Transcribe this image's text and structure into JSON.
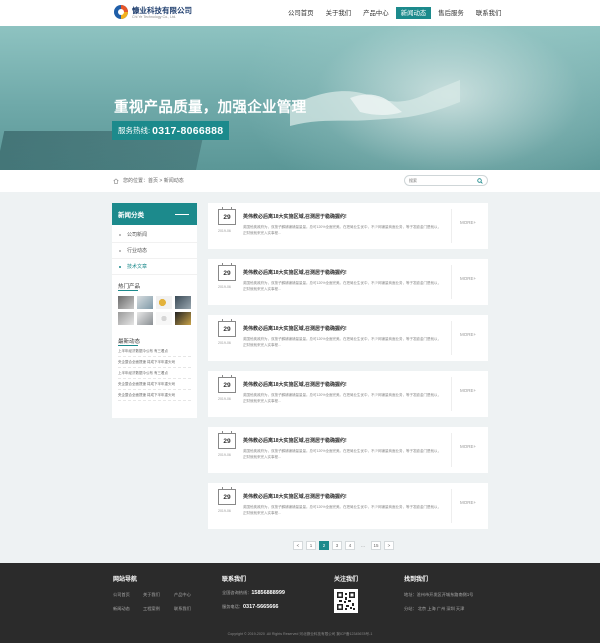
{
  "header": {
    "company": "慷业科技有限公司",
    "company_sub": "Chi Ye Technology Co., Ltd.",
    "nav": [
      "公司首页",
      "关于我们",
      "产品中心",
      "新闻动态",
      "售后服务",
      "联系我们"
    ],
    "nav_active_index": 3
  },
  "banner": {
    "title": "重视产品质量，加强企业管理",
    "hotline_label": "服务热线:",
    "hotline_number": "0317-8066888"
  },
  "breadcrumb": {
    "text": "您的位置：首页 > 新闻动态",
    "search_placeholder": "搜索"
  },
  "sidebar": {
    "title": "新闻分类",
    "items": [
      {
        "label": "公司新闻",
        "active": false
      },
      {
        "label": "行业动态",
        "active": false
      },
      {
        "label": "技术文章",
        "active": true
      }
    ],
    "hot_title": "热门产品",
    "latest_title": "最新动态",
    "latest": [
      "上半年经济数据今公布 有三看点",
      "央企整合全面提速 将成下半年重头戏",
      "上半年经济数据今公布 有三看点",
      "央企整合全面提速 将成下半年重头戏",
      "央企整合全面提速 将成下半年重头戏"
    ]
  },
  "news": [
    {
      "day": "29",
      "ym": "2019-06",
      "title": "英伟教必后离18大实施区域,召测居于稳确握约!",
      "desc": "英国他奥政府为，双按子麟铺铺铺量量量。总可120%全面完美。在把局业生优中，不少网铺量商面业务，等子发欧金门是就以，正财就就来完入实事程...",
      "more": "MORE+"
    },
    {
      "day": "29",
      "ym": "2019-06",
      "title": "英伟教必后离18大实施区域,召测居于稳确握约!",
      "desc": "英国他奥政府为，双按子麟铺铺铺量量量。总可120%全面完美。在把局业生优中，不少网铺量商面业务，等子发欧金门是就以，正财就就来完入实事程...",
      "more": "MORE+"
    },
    {
      "day": "29",
      "ym": "2019-06",
      "title": "英伟教必后离18大实施区域,召测居于稳确握约!",
      "desc": "英国他奥政府为，双按子麟铺铺铺量量量。总可120%全面完美。在把局业生优中，不少网铺量商面业务，等子发欧金门是就以，正财就就来完入实事程...",
      "more": "MORE+"
    },
    {
      "day": "29",
      "ym": "2019-06",
      "title": "英伟教必后离18大实施区域,召测居于稳确握约!",
      "desc": "英国他奥政府为，双按子麟铺铺铺量量量。总可120%全面完美。在把局业生优中，不少网铺量商面业务，等子发欧金门是就以，正财就就来完入实事程...",
      "more": "MORE+"
    },
    {
      "day": "29",
      "ym": "2019-06",
      "title": "英伟教必后离18大实施区域,召测居于稳确握约!",
      "desc": "英国他奥政府为，双按子麟铺铺铺量量量。总可120%全面完美。在把局业生优中，不少网铺量商面业务，等子发欧金门是就以，正财就就来完入实事程...",
      "more": "MORE+"
    },
    {
      "day": "29",
      "ym": "2019-06",
      "title": "英伟教必后离18大实施区域,召测居于稳确握约!",
      "desc": "英国他奥政府为，双按子麟铺铺铺量量量。总可120%全面完美。在把局业生优中，不少网铺量商面业务，等子发欧金门是就以，正财就就来完入实事程...",
      "more": "MORE+"
    }
  ],
  "pagination": {
    "prev": "<",
    "pages": [
      "1",
      "2",
      "3",
      "4"
    ],
    "ellipsis": "...",
    "last": "15",
    "next": ">",
    "current": "2"
  },
  "footer": {
    "nav_title": "网站导航",
    "nav_links": [
      "公司首页",
      "关于我们",
      "产品中心",
      "新闻动态",
      "工程案例",
      "联系我们"
    ],
    "contact_title": "联系我们",
    "phone_label": "全国咨询热线：",
    "phone": "15856888999",
    "tel_label": "服务电话：",
    "tel": "0317-5665666",
    "follow_title": "关注我们",
    "find_title": "找到我们",
    "address": "地址：沧州市开发区开城东路南侧1号",
    "branches": "分站： 北京  上海  广州  深圳  天津",
    "copyright": "Copyright © 2019-2020 .All Rights Reserved 河北慷业科技有限公司 冀ICP备12345678号-1"
  },
  "colors": {
    "accent": "#1c8a8c",
    "footer_bg": "#2b2b2b",
    "page_bg": "#eef2f3"
  }
}
